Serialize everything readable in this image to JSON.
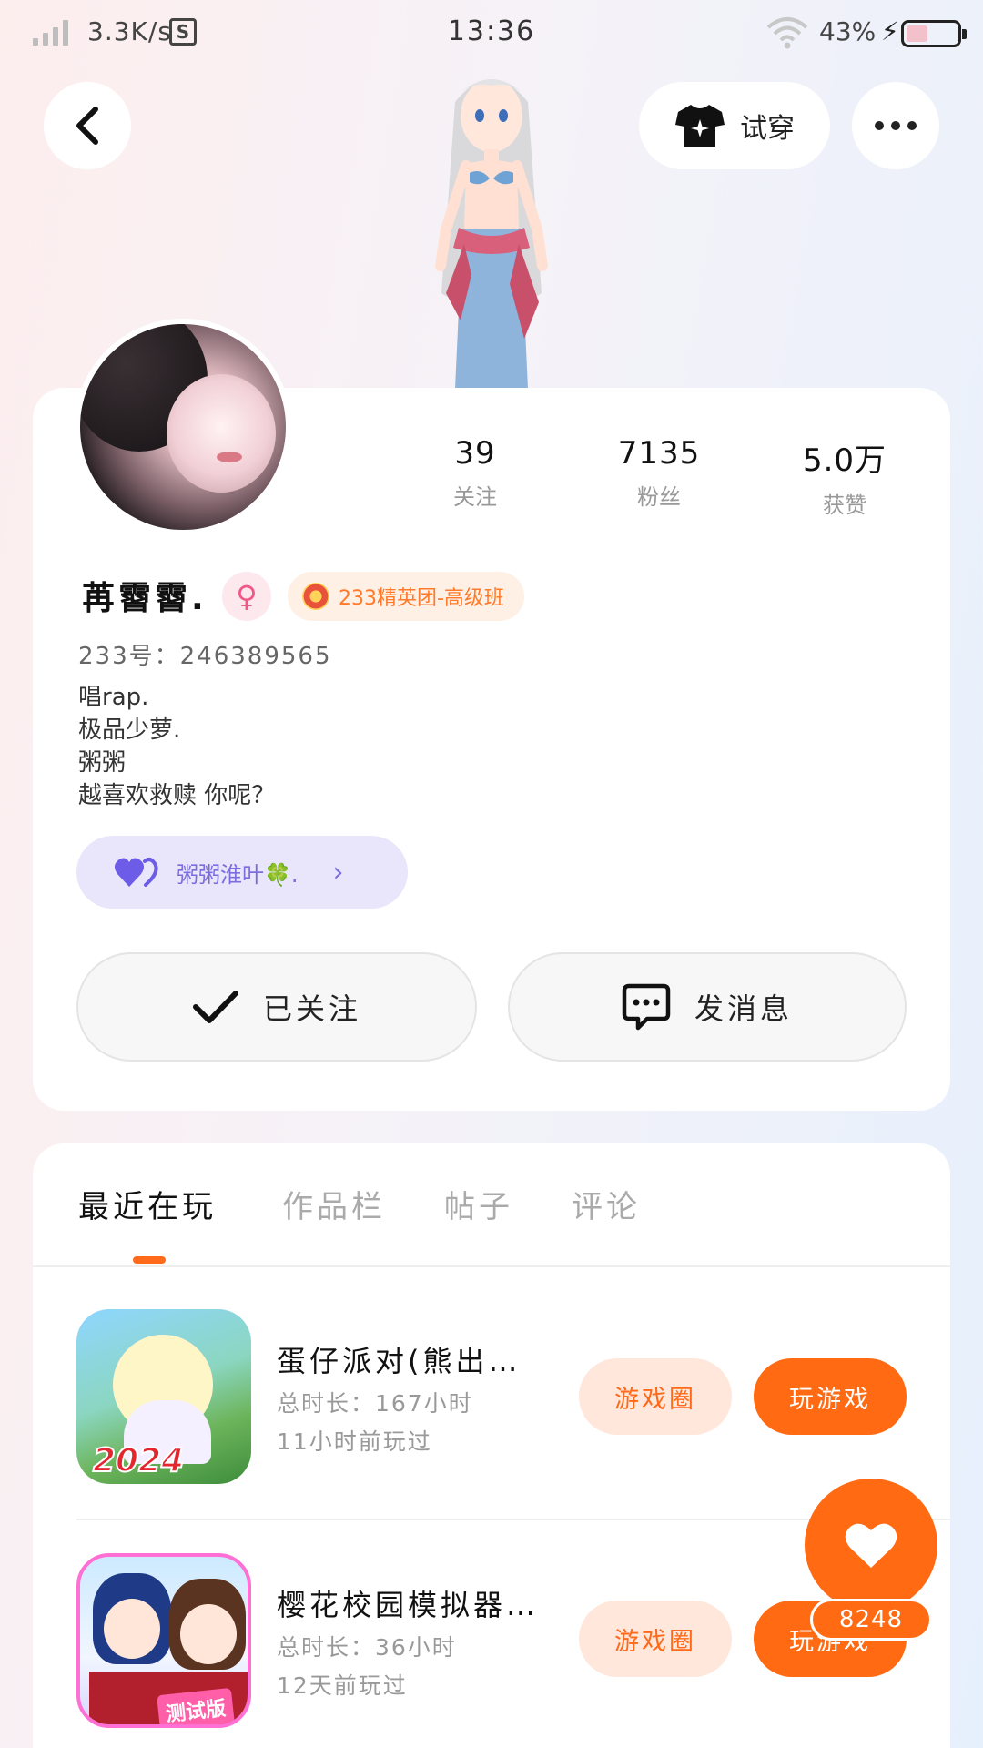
{
  "status_bar": {
    "net_speed": "3.3K/s",
    "s_badge": "S",
    "time": "13:36",
    "battery_percent": "43%",
    "battery_level": 0.43
  },
  "header": {
    "try_on_label": "试穿"
  },
  "profile": {
    "stats": [
      {
        "value": "39",
        "label": "关注"
      },
      {
        "value": "7135",
        "label": "粉丝"
      },
      {
        "value": "5.0万",
        "label": "获赞"
      }
    ],
    "nickname": "苒霫霫.",
    "gender_symbol": "♀",
    "level_badge": "233精英团-高级班",
    "uid": "233号：246389565",
    "bio_lines": [
      "唱rap.",
      "极品少萝.",
      "粥粥",
      "越喜欢救赎 你呢？"
    ],
    "fan_club": "粥粥淮叶🍀.",
    "follow_label": "已关注",
    "message_label": "发消息"
  },
  "tabs": [
    "最近在玩",
    "作品栏",
    "帖子",
    "评论"
  ],
  "games": [
    {
      "title": "蛋仔派对(熊出…",
      "total_time": "总时长：167小时",
      "last_played": "11小时前玩过",
      "circle_label": "游戏圈",
      "play_label": "玩游戏",
      "icon_text": "2024"
    },
    {
      "title": "樱花校园模拟器…",
      "total_time": "总时长：36小时",
      "last_played": "12天前玩过",
      "circle_label": "游戏圈",
      "play_label": "玩游戏",
      "icon_text": "测试版"
    }
  ],
  "like_fab": {
    "count": "8248"
  },
  "colors": {
    "accent": "#ff6a12",
    "accent_soft": "#ffe7dc",
    "fan_club_bg": "#e9e6fb",
    "fan_club_text": "#7b6ddc"
  }
}
